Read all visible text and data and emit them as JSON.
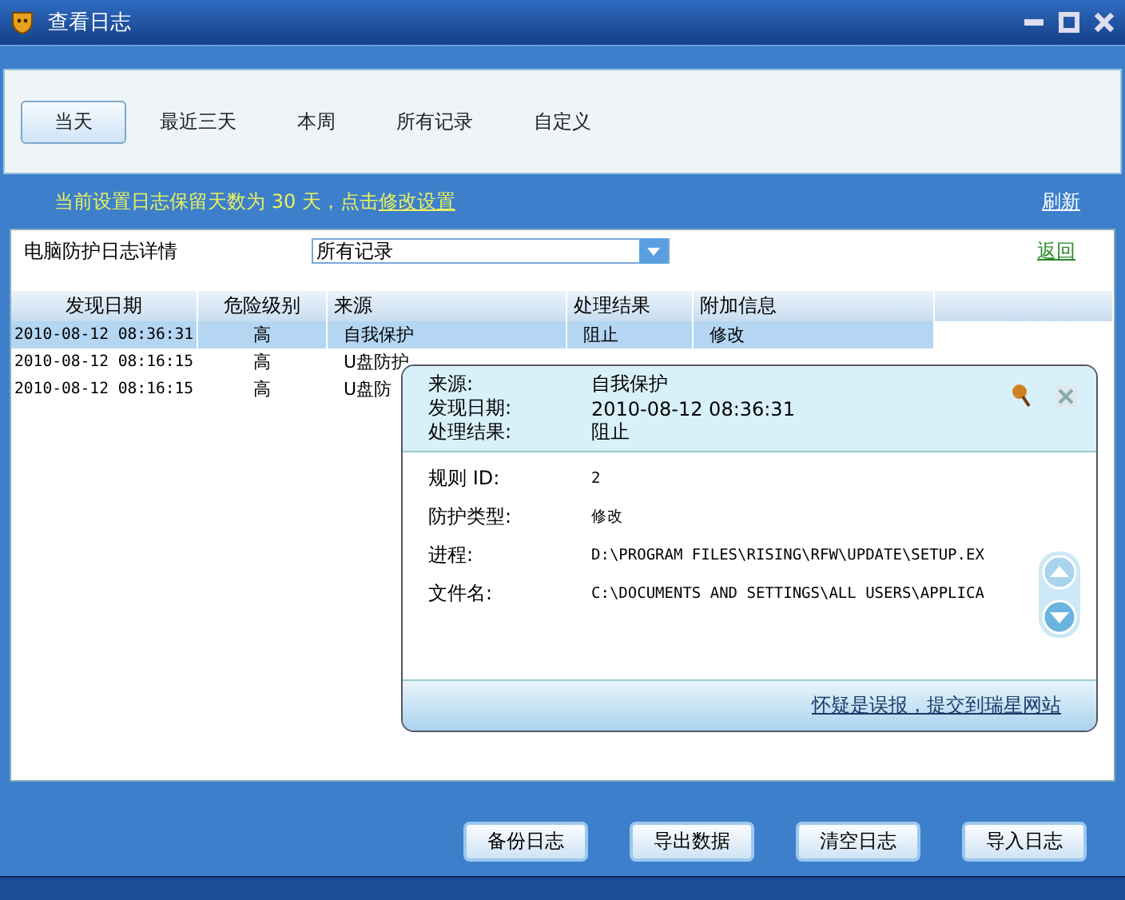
{
  "window": {
    "title": "查看日志"
  },
  "tabs": [
    {
      "label": "当天",
      "selected": true
    },
    {
      "label": "最近三天",
      "selected": false
    },
    {
      "label": "本周",
      "selected": false
    },
    {
      "label": "所有记录",
      "selected": false
    },
    {
      "label": "自定义",
      "selected": false
    }
  ],
  "notice": {
    "text": "当前设置日志保留天数为 30 天，点击",
    "link": "修改设置",
    "refresh": "刷新"
  },
  "filter": {
    "label": "电脑防护日志详情",
    "value": "所有记录",
    "back": "返回"
  },
  "table": {
    "columns": [
      "发现日期",
      "危险级别",
      "来源",
      "处理结果",
      "附加信息"
    ],
    "rows": [
      {
        "selected": true,
        "cells": [
          "2010-08-12 08:36:31",
          "高",
          "自我保护",
          "阻止",
          "修改"
        ]
      },
      {
        "selected": false,
        "cells": [
          "2010-08-12 08:16:15",
          "高",
          "U盘防护"
        ]
      },
      {
        "selected": false,
        "cells": [
          "2010-08-12 08:16:15",
          "高",
          "U盘防"
        ]
      }
    ]
  },
  "popup": {
    "header": [
      {
        "label": "来源:",
        "value": "自我保护"
      },
      {
        "label": "发现日期:",
        "value": "2010-08-12 08:36:31"
      },
      {
        "label": "处理结果:",
        "value": "阻止"
      }
    ],
    "details": [
      {
        "label": "规则 ID:",
        "value": "2"
      },
      {
        "label": "防护类型:",
        "value": "修改"
      },
      {
        "label": "进程:",
        "value": "D:\\PROGRAM FILES\\RISING\\RFW\\UPDATE\\SETUP.EX"
      },
      {
        "label": "文件名:",
        "value": "C:\\DOCUMENTS AND SETTINGS\\ALL USERS\\APPLICA"
      }
    ],
    "link": "怀疑是误报，提交到瑞星网站"
  },
  "buttons": [
    "备份日志",
    "导出数据",
    "清空日志",
    "导入日志"
  ]
}
